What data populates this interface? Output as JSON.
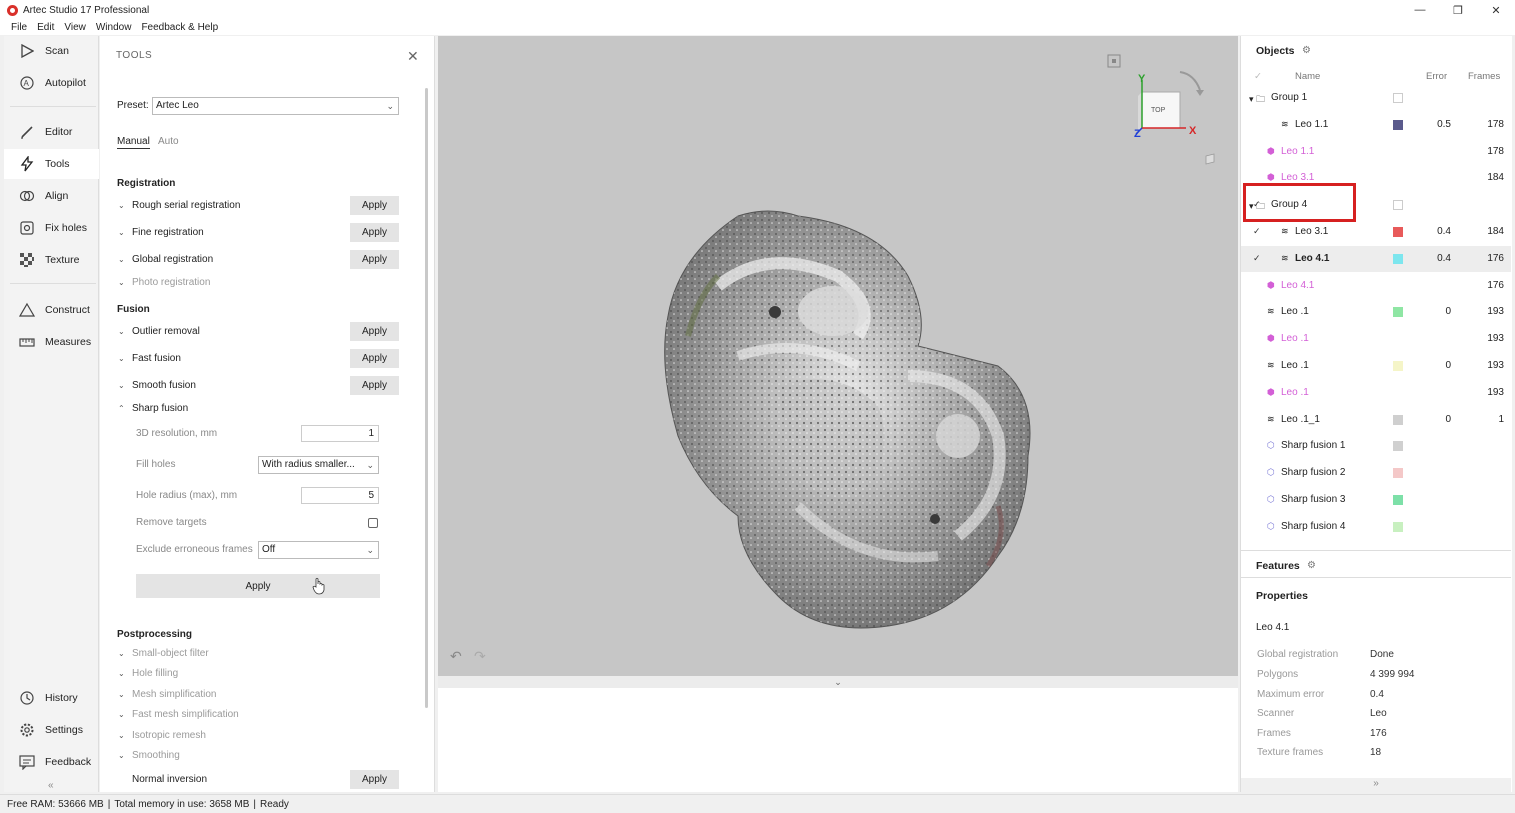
{
  "window": {
    "title": "Artec Studio 17 Professional",
    "controls": [
      "—",
      "❐",
      "✕"
    ]
  },
  "menu": [
    "File",
    "Edit",
    "View",
    "Window",
    "Feedback & Help"
  ],
  "nav": {
    "scan": "Scan",
    "autopilot": "Autopilot",
    "editor": "Editor",
    "tools": "Tools",
    "align": "Align",
    "fix_holes": "Fix holes",
    "texture": "Texture",
    "construct": "Construct",
    "measures": "Measures",
    "history": "History",
    "settings": "Settings",
    "feedback": "Feedback",
    "collapse": "«",
    "active": "Tools"
  },
  "tools": {
    "title": "TOOLS",
    "close": "✕",
    "preset_label": "Preset:",
    "preset_value": "Artec Leo",
    "tab_manual": "Manual",
    "tab_auto": "Auto",
    "registration_title": "Registration",
    "rough_serial": "Rough serial registration",
    "fine": "Fine registration",
    "global": "Global registration",
    "photo": "Photo registration",
    "fusion_title": "Fusion",
    "outlier": "Outlier removal",
    "fast_fusion": "Fast fusion",
    "smooth_fusion": "Smooth fusion",
    "sharp_fusion": "Sharp fusion",
    "res_label": "3D resolution, mm",
    "res_value": "1",
    "fill_holes_label": "Fill holes",
    "fill_holes_value": "With radius smaller...",
    "hole_radius_label": "Hole radius (max), mm",
    "hole_radius_value": "5",
    "remove_targets_label": "Remove targets",
    "remove_targets_checked": false,
    "exclude_label": "Exclude erroneous frames",
    "exclude_value": "Off",
    "apply": "Apply",
    "postprocessing_title": "Postprocessing",
    "small_object": "Small-object filter",
    "hole_filling": "Hole filling",
    "mesh_simpl": "Mesh simplification",
    "fast_mesh_simpl": "Fast mesh simplification",
    "isotropic": "Isotropic remesh",
    "smoothing": "Smoothing",
    "normal_inversion": "Normal inversion"
  },
  "viewport": {
    "view_cube_label": "TOP",
    "axis_y": "Y",
    "axis_x": "X",
    "axis_z": "Z",
    "undo": "↶",
    "redo": "↷",
    "split_handle": "⌄"
  },
  "objects": {
    "title": "Objects",
    "col_name": "Name",
    "col_error": "Error",
    "col_frames": "Frames",
    "rows": [
      {
        "name": "Group 1",
        "type": "group",
        "error": "",
        "frames": "",
        "color": "",
        "checked": false
      },
      {
        "name": "Leo 1.1",
        "type": "scan",
        "error": "0.5",
        "frames": "178",
        "color": "#5a5a8c",
        "checked": false
      },
      {
        "name": "Leo 1.1",
        "type": "model",
        "error": "",
        "frames": "178",
        "color": "",
        "checked": false
      },
      {
        "name": "Leo 3.1",
        "type": "model",
        "error": "",
        "frames": "184",
        "color": "",
        "checked": false
      },
      {
        "name": "Group 4",
        "type": "group",
        "error": "",
        "frames": "",
        "color": "",
        "checked": true
      },
      {
        "name": "Leo 3.1",
        "type": "scan",
        "error": "0.4",
        "frames": "184",
        "color": "#e85a5a",
        "checked": true
      },
      {
        "name": "Leo 4.1",
        "type": "scan",
        "error": "0.4",
        "frames": "176",
        "color": "#7de6ee",
        "checked": true
      },
      {
        "name": "Leo 4.1",
        "type": "model",
        "error": "",
        "frames": "176",
        "color": "",
        "checked": false
      },
      {
        "name": "Leo .1",
        "type": "scan",
        "error": "0",
        "frames": "193",
        "color": "#8fe6a4",
        "checked": false
      },
      {
        "name": "Leo .1",
        "type": "model",
        "error": "",
        "frames": "193",
        "color": "",
        "checked": false
      },
      {
        "name": "Leo .1",
        "type": "scan",
        "error": "0",
        "frames": "193",
        "color": "#f5f5c8",
        "checked": false
      },
      {
        "name": "Leo .1",
        "type": "model",
        "error": "",
        "frames": "193",
        "color": "",
        "checked": false
      },
      {
        "name": "Leo .1_1",
        "type": "scan",
        "error": "0",
        "frames": "1",
        "color": "#cfcfcf",
        "checked": false
      },
      {
        "name": "Sharp fusion 1",
        "type": "fusion",
        "error": "",
        "frames": "",
        "color": "#d0d0d0",
        "checked": false
      },
      {
        "name": "Sharp fusion 2",
        "type": "fusion",
        "error": "",
        "frames": "",
        "color": "#f4c8c8",
        "checked": false
      },
      {
        "name": "Sharp fusion 3",
        "type": "fusion",
        "error": "",
        "frames": "",
        "color": "#7de0a8",
        "checked": false
      },
      {
        "name": "Sharp fusion 4",
        "type": "fusion",
        "error": "",
        "frames": "",
        "color": "#c8f0c0",
        "checked": false
      }
    ]
  },
  "features": {
    "title": "Features"
  },
  "properties": {
    "title": "Properties",
    "object_name": "Leo 4.1",
    "items": [
      {
        "key": "Global registration",
        "value": "Done"
      },
      {
        "key": "Polygons",
        "value": "4 399 994"
      },
      {
        "key": "Maximum error",
        "value": "0.4"
      },
      {
        "key": "Scanner",
        "value": "Leo"
      },
      {
        "key": "Frames",
        "value": "176"
      },
      {
        "key": "Texture frames",
        "value": "18"
      }
    ],
    "expand": "»"
  },
  "status": {
    "free_ram": "Free RAM: 53666 MB",
    "sep": "|",
    "total_mem": "Total memory in use: 3658 MB",
    "state": "Ready"
  },
  "colors": {
    "accent_red": "#d62020",
    "model_pink": "#d35fd6",
    "viewport_bg": "#c6c6c6"
  }
}
